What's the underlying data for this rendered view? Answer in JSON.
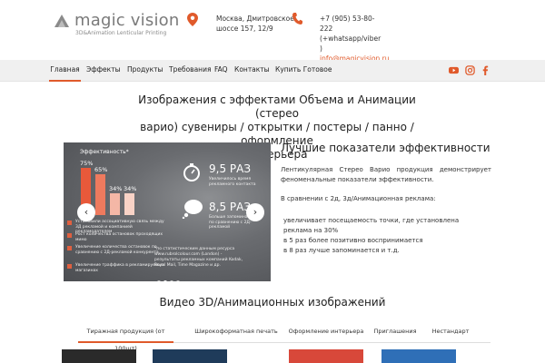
{
  "header": {
    "logo_name": "magic vision",
    "logo_tagline": "3D&Animation Lenticular Printing",
    "address_line1": "Москва, Дмитровское",
    "address_line2": "шоссе 157, 12/9",
    "phone_line1": "+7 (905) 53-80-",
    "phone_line2": "222",
    "phone_line3": "(+whatsapp/viber",
    "phone_line4": ")",
    "email": "info@magicvision.ru",
    "accent_color": "#e05a2b"
  },
  "nav": {
    "items": [
      "Главная",
      "Эффекты",
      "Продукты",
      "Требования",
      "FAQ",
      "Контакты",
      "Купить Готовое"
    ],
    "active_index": 0,
    "social": [
      "youtube-icon",
      "instagram-icon",
      "facebook-icon"
    ]
  },
  "headline": {
    "line1": "Изображения с эффектами Объема и Анимации (стерео",
    "line2": "варио) сувениры / открытки / постеры / панно / оформление",
    "line3": "интерьера"
  },
  "slider": {
    "title": "Эффективность*",
    "bars": [
      {
        "label": "75%",
        "value": 75,
        "color": "#e8593a"
      },
      {
        "label": "65%",
        "value": 65,
        "color": "#ee7a5e"
      },
      {
        "label": "34%",
        "value": 34,
        "color": "#f4b7a6"
      },
      {
        "label": "34%",
        "value": 34,
        "color": "#f8d2c6"
      }
    ],
    "legend": [
      "Установили ассоциативную связь между 3Д рекламой и компанией рекламодателем",
      "Рост количества остановок проходящих мимо",
      "Увеличение количества остановок по сравнению с 2Д-рекламой конкурента",
      "Увеличение траффика в рекламируемых магазинах"
    ],
    "stat1_value": "9,5 РАЗ",
    "stat1_text": "Увеличилось время рекламного контакта",
    "stat2_value": "8,5 РАЗ",
    "stat2_text": "Больше запоминаются по сравнению с 2Д-рекламой",
    "source": "*по статистическим данным ресурса www.rubrolcolour.com (London) - результаты рекламных компаний Kodak, Royal Mail, Time Magazine и др.",
    "prev_symbol": "‹",
    "next_symbol": "›",
    "slide_count": 4,
    "active_slide": 1
  },
  "info": {
    "title": "Лучшие показатели эффективности",
    "p1": "Лентикулярная Стерео Варио продукция демонстрирует феноменальные показатели эффективности.",
    "p2": "В сравнении с 2д, 3д/Анимационная реклама:",
    "p3_line1": "увеличивает посещаемость точки, где установлена",
    "p3_line2": "реклама на 30%",
    "p3_line3": "в 5 раз более позитивно воспринимается",
    "p3_line4": "в 8 раз лучше запоминается и т.д."
  },
  "video": {
    "title": "Видео 3D/Анимационных изображений",
    "tabs": [
      "Тиражная продукция (от 100шт)",
      "Широкоформатная печать",
      "Оформление интерьера",
      "Приглашения",
      "Нестандарт"
    ],
    "active_tab": 0
  }
}
